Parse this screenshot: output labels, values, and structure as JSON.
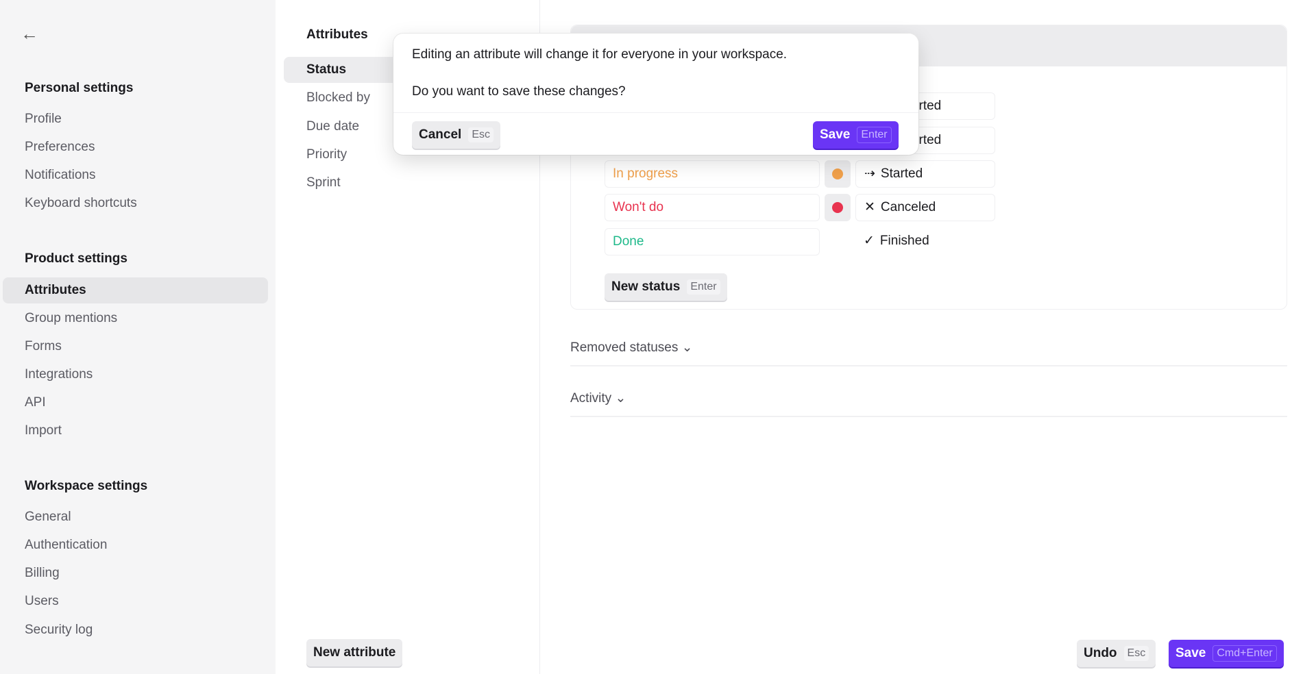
{
  "sidebar": {
    "back_icon": "arrow-left-icon",
    "sections": [
      {
        "title": "Personal settings",
        "items": [
          "Profile",
          "Preferences",
          "Notifications",
          "Keyboard shortcuts"
        ]
      },
      {
        "title": "Product settings",
        "items": [
          "Attributes",
          "Group mentions",
          "Forms",
          "Integrations",
          "API",
          "Import"
        ]
      },
      {
        "title": "Workspace settings",
        "items": [
          "General",
          "Authentication",
          "Billing",
          "Users",
          "Security log"
        ]
      }
    ],
    "active": "Attributes"
  },
  "attributes": {
    "title": "Attributes",
    "items": [
      "Status",
      "Blocked by",
      "Due date",
      "Priority",
      "Sprint"
    ],
    "active": "Status",
    "new_button": "New attribute"
  },
  "statuses": {
    "rows": [
      {
        "label": "",
        "color": "#1fb98a",
        "type": "Not started",
        "type_icon": "circle-icon"
      },
      {
        "label": "",
        "color": "#1fb98a",
        "type": "Not started",
        "type_icon": "circle-icon"
      },
      {
        "label": "In progress",
        "color": "#f0a04b",
        "type": "Started",
        "type_icon": "arrow-right-icon"
      },
      {
        "label": "Won't do",
        "color": "#e8334f",
        "type": "Canceled",
        "type_icon": "x-icon"
      },
      {
        "label": "Done",
        "color": "#1fb98a",
        "type": "Finished",
        "type_icon": "check-icon"
      }
    ],
    "new_status": "New status",
    "new_status_key": "Enter"
  },
  "removed_statuses": "Removed statuses",
  "activity": "Activity",
  "footer": {
    "undo": "Undo",
    "undo_key": "Esc",
    "save": "Save",
    "save_key": "Cmd+Enter"
  },
  "modal": {
    "line1": "Editing an attribute will change it for everyone in your workspace.",
    "line2": "Do you want to save these changes?",
    "cancel": "Cancel",
    "cancel_key": "Esc",
    "save": "Save",
    "save_key": "Enter"
  },
  "colors": {
    "accent": "#6a35f5"
  }
}
